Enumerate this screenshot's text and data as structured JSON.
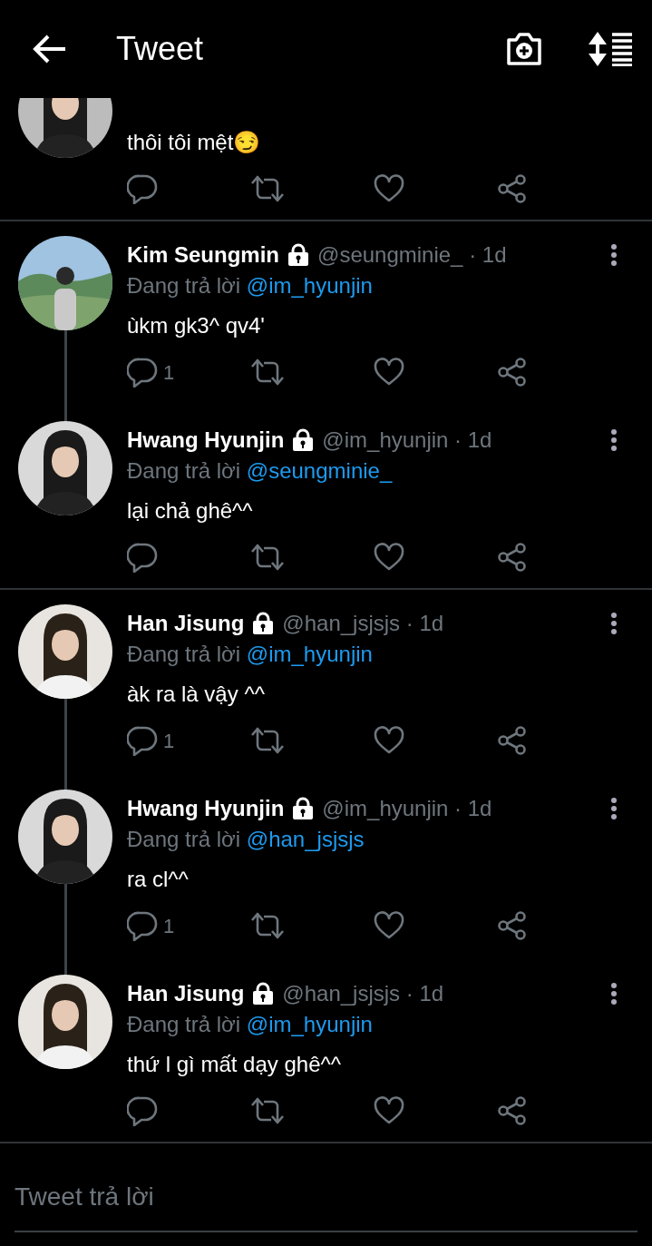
{
  "header": {
    "title": "Tweet"
  },
  "threads": [
    {
      "tweets": [
        {
          "kind": "cut",
          "text": "thôi tôi mệt😏"
        }
      ]
    },
    {
      "tweets": [
        {
          "kind": "full",
          "name": "Kim Seungmin",
          "locked": true,
          "meta": "@seungminie_ · 1d",
          "reply_prefix": "Đang trả lời",
          "reply_to": "@im_hyunjin",
          "text": "ùkm gk3^ qv4'",
          "reply_count": "1"
        },
        {
          "kind": "full",
          "name": "Hwang Hyunjin",
          "locked": true,
          "meta": "@im_hyunjin · 1d",
          "reply_prefix": "Đang trả lời",
          "reply_to": "@seungminie_",
          "text": "lại chả ghê^^"
        }
      ]
    },
    {
      "tweets": [
        {
          "kind": "full",
          "name": "Han Jisung",
          "locked": true,
          "meta": "@han_jsjsjs · 1d",
          "reply_prefix": "Đang trả lời",
          "reply_to": "@im_hyunjin",
          "text": "àk ra là vậy ^^",
          "reply_count": "1"
        },
        {
          "kind": "full",
          "name": "Hwang Hyunjin",
          "locked": true,
          "meta": "@im_hyunjin · 1d",
          "reply_prefix": "Đang trả lời",
          "reply_to": "@han_jsjsjs",
          "text": "ra cl^^",
          "reply_count": "1"
        },
        {
          "kind": "full",
          "name": "Han Jisung",
          "locked": true,
          "meta": "@han_jsjsjs · 1d",
          "reply_prefix": "Đang trả lời",
          "reply_to": "@im_hyunjin",
          "text": "thứ l gì mất dạy ghê^^"
        }
      ]
    }
  ],
  "reply_field": {
    "placeholder": "Tweet trả lời"
  }
}
